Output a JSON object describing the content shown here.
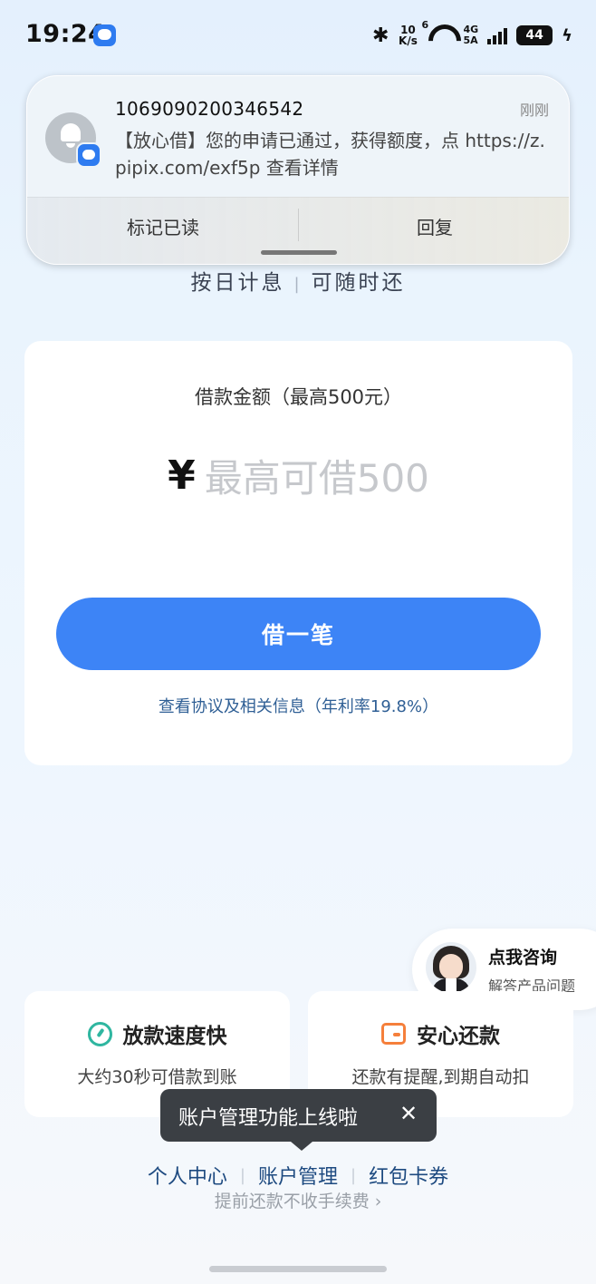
{
  "status_bar": {
    "time": "19:24",
    "bluetooth": "✱",
    "speed_top": "10",
    "speed_bottom": "K/s",
    "wifi_sup": "6",
    "network_top": "4G",
    "network_bottom": "5A",
    "battery": "44",
    "charging": "ϟ"
  },
  "notification": {
    "sender": "1069090200346542",
    "time": "刚刚",
    "body": "【放心借】您的申请已通过，获得额度，点 https://z.pipix.com/exf5p 查看详情",
    "action_mark_read": "标记已读",
    "action_reply": "回复"
  },
  "tagline": {
    "left": "按日计息",
    "sep": "|",
    "right": "可随时还"
  },
  "loan": {
    "label": "借款金额（最高500元）",
    "currency": "¥",
    "placeholder": "最高可借500",
    "button": "借一笔",
    "agreement": "查看协议及相关信息（年利率19.8%）"
  },
  "consult": {
    "title": "点我咨询",
    "subtitle": "解答产品问题"
  },
  "features": [
    {
      "title": "放款速度快",
      "desc": "大约30秒可借款到账",
      "icon": "speed-icon",
      "color": "#2fb6a0"
    },
    {
      "title": "安心还款",
      "desc": "还款有提醒,到期自动扣",
      "icon": "wallet-icon",
      "color": "#f57f3b"
    }
  ],
  "toast": {
    "text": "账户管理功能上线啦",
    "close": "✕"
  },
  "links": {
    "personal": "个人中心",
    "account": "账户管理",
    "coupons": "红包卡券",
    "sep": "|"
  },
  "footer": {
    "text": "提前还款不收手续费",
    "chevron": "›"
  },
  "colors": {
    "primary": "#3d84f6",
    "link": "#1d4a80",
    "toast_bg": "#3b3f44"
  }
}
